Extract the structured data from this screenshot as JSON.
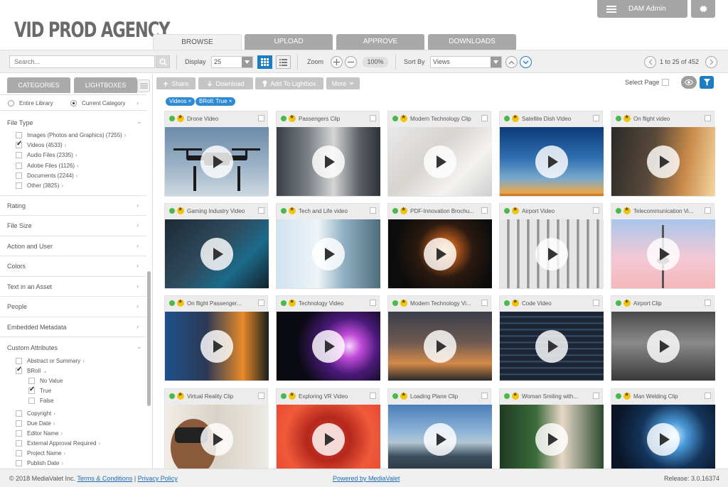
{
  "app": {
    "logo": "VID PROD AGENCY",
    "admin_label": "DAM Admin"
  },
  "tabs": [
    "BROWSE",
    "UPLOAD",
    "APPROVE",
    "DOWNLOADS"
  ],
  "toolbar": {
    "search_placeholder": "Search...",
    "display_label": "Display",
    "display_value": "25",
    "zoom_label": "Zoom",
    "zoom_value": "100%",
    "sort_label": "Sort By",
    "sort_value": "Views",
    "pager": "1 to 25 of 452"
  },
  "sidebar": {
    "tabs": [
      "CATEGORIES",
      "LIGHTBOXES"
    ],
    "scope": [
      "Entire Library",
      "Current Category"
    ],
    "file_type_title": "File Type",
    "file_types": [
      {
        "label": "Images (Photos and Graphics) (7255)",
        "checked": false
      },
      {
        "label": "Videos (4533)",
        "checked": true
      },
      {
        "label": "Audio Files (2335)",
        "checked": false
      },
      {
        "label": "Adobe Files (1126)",
        "checked": false
      },
      {
        "label": "Documents (2244)",
        "checked": false
      },
      {
        "label": "Other (3825)",
        "checked": false
      }
    ],
    "sections": [
      "Rating",
      "File Size",
      "Action and User",
      "Colors",
      "Text in an Asset",
      "People",
      "Embedded Metadata"
    ],
    "custom_title": "Custom Attributes",
    "custom_items": {
      "abstract": "Abstract or Summary",
      "broll": "BRoll",
      "broll_options": [
        "No Value",
        "True",
        "False"
      ],
      "rest": [
        "Copyright",
        "Due Date",
        "Editor Name",
        "External Approval Required",
        "Project Name",
        "Publish Date"
      ]
    }
  },
  "actions": {
    "share": "Share",
    "download": "Download",
    "lightbox": "Add To Lightbox",
    "more": "More",
    "select_page": "Select Page"
  },
  "filter_chips": [
    "Videos",
    "BRoll: True"
  ],
  "cards": [
    {
      "title": "Drone Video"
    },
    {
      "title": "Passengers Clip"
    },
    {
      "title": "Modern Technology Clip"
    },
    {
      "title": "Satellite Dish Video"
    },
    {
      "title": "On flight video"
    },
    {
      "title": "Gaming Industry Video"
    },
    {
      "title": "Tech and Life video"
    },
    {
      "title": "PDF-Innovation Brochu..."
    },
    {
      "title": "Airport Video"
    },
    {
      "title": "Telecommunication Vi..."
    },
    {
      "title": "On flight Passenger..."
    },
    {
      "title": "Technology Video"
    },
    {
      "title": "Modern Technology Vi..."
    },
    {
      "title": "Code Video"
    },
    {
      "title": "Airport Clip"
    },
    {
      "title": "Virtual Reality Clip"
    },
    {
      "title": "Exploring VR Video"
    },
    {
      "title": "Loading Plane Clip"
    },
    {
      "title": "Woman Smiling with..."
    },
    {
      "title": "Man Welding Clip"
    }
  ],
  "footer": {
    "copyright": "© 2018 MediaValet Inc.",
    "terms": "Terms & Conditions",
    "separator": "|",
    "privacy": "Privacy Policy",
    "powered": "Powered by MediaValet",
    "release": "Release: 3.0.16374"
  }
}
